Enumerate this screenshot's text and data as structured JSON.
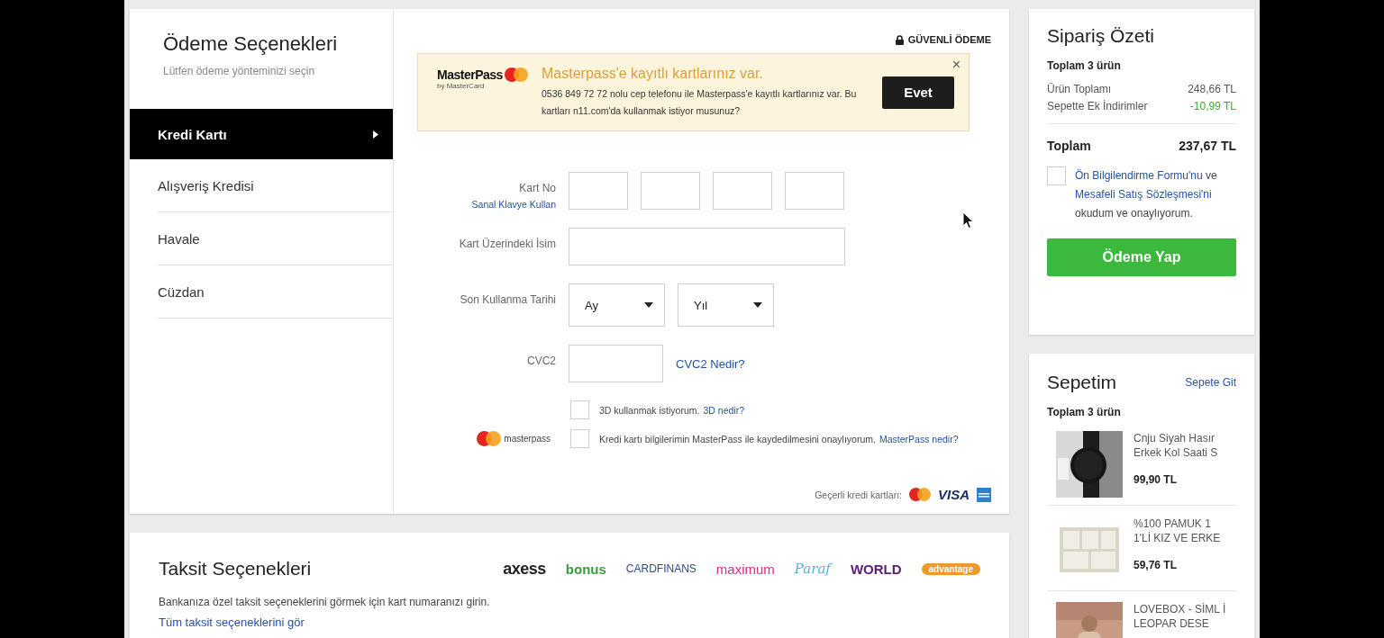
{
  "payment": {
    "title": "Ödeme Seçenekleri",
    "subtitle": "Lütfen ödeme yönteminizi seçin",
    "methods": [
      {
        "label": "Kredi Kartı",
        "selected": true
      },
      {
        "label": "Alışveriş Kredisi",
        "selected": false
      },
      {
        "label": "Havale",
        "selected": false
      },
      {
        "label": "Cüzdan",
        "selected": false
      }
    ]
  },
  "secure_label": "GÜVENLİ ÖDEME",
  "masterpass_banner": {
    "brand": "MasterPass",
    "brand_sub": "by MasterCard",
    "title": "Masterpass'e kayıtlı kartlarınız var.",
    "text": "0536 849 72 72 nolu cep telefonu ile Masterpass'e kayıtlı kartlarınız var. Bu kartları n11.com'da kullanmak istiyor musunuz?",
    "button": "Evet",
    "close": "×"
  },
  "form": {
    "card_no_label": "Kart No",
    "virtual_keyboard_link": "Sanal Klavye Kullan",
    "name_label": "Kart Üzerindeki İsim",
    "expiry_label": "Son Kullanma Tarihi",
    "month": "Ay",
    "year": "Yıl",
    "cvc_label": "CVC2",
    "cvc_link": "CVC2 Nedir?",
    "options": [
      {
        "kind": "plain",
        "text": "3D kullanmak istiyorum.",
        "link": "3D nedir?",
        "checked": false
      },
      {
        "kind": "masterpass",
        "logo": "masterpass",
        "text": "Kredi kartı bilgilerimin MasterPass ile kaydedilmesini onaylıyorum.",
        "link": "MasterPass nedir?",
        "checked": false
      }
    ],
    "valid_cards_label": "Geçerli kredi kartları:",
    "visa": "VISA"
  },
  "installments": {
    "title": "Taksit Seçenekleri",
    "text": "Bankanıza özel taksit seçeneklerini görmek için kart numaranızı girin.",
    "link": "Tüm taksit seçeneklerini gör",
    "banks": [
      {
        "name": "axess",
        "color": "#222222"
      },
      {
        "name": "bonus",
        "color": "#3a9a3f"
      },
      {
        "name": "CARDFINANS",
        "color": "#2c4a8c"
      },
      {
        "name": "maximum",
        "color": "#d92b8a"
      },
      {
        "name": "Paraf",
        "color": "#4fb3e3"
      },
      {
        "name": "WORLD",
        "color": "#5a1e78"
      },
      {
        "name": "advantage",
        "color": "#ee9a2a"
      }
    ]
  },
  "summary": {
    "title": "Sipariş Özeti",
    "count": "Toplam 3 ürün",
    "lines": [
      {
        "label": "Ürün Toplamı",
        "value": "248,66 TL",
        "kind": "normal"
      },
      {
        "label": "Sepette Ek İndirimler",
        "value": "-10,99 TL",
        "kind": "discount"
      }
    ],
    "total_label": "Toplam",
    "total_value": "237,67 TL",
    "agree_checked": false,
    "agreement": [
      {
        "text": "Ön Bilgilendirme Formu'nu",
        "link": true
      },
      {
        "text": "ve",
        "link": false
      },
      {
        "text": "Mesafeli Satış",
        "link": true
      },
      {
        "text": "Sözleşmesi'ni",
        "link": true
      },
      {
        "text": "okudum ve onaylıyorum.",
        "link": false
      }
    ],
    "pay_button": "Ödeme Yap"
  },
  "basket": {
    "title": "Sepetim",
    "link": "Sepete Git",
    "count": "Toplam 3 ürün",
    "items": [
      {
        "kind": "watch",
        "name": "Cnju Siyah Hasır Erkek Kol Saati S",
        "price": "99,90 TL"
      },
      {
        "kind": "clothes",
        "name": "%100 PAMUK 1 1'Lİ KIZ VE ERKE",
        "price": "59,76 TL"
      },
      {
        "kind": "person",
        "name": "LOVEBOX - SİML İ LEOPAR DESE"
      }
    ]
  }
}
